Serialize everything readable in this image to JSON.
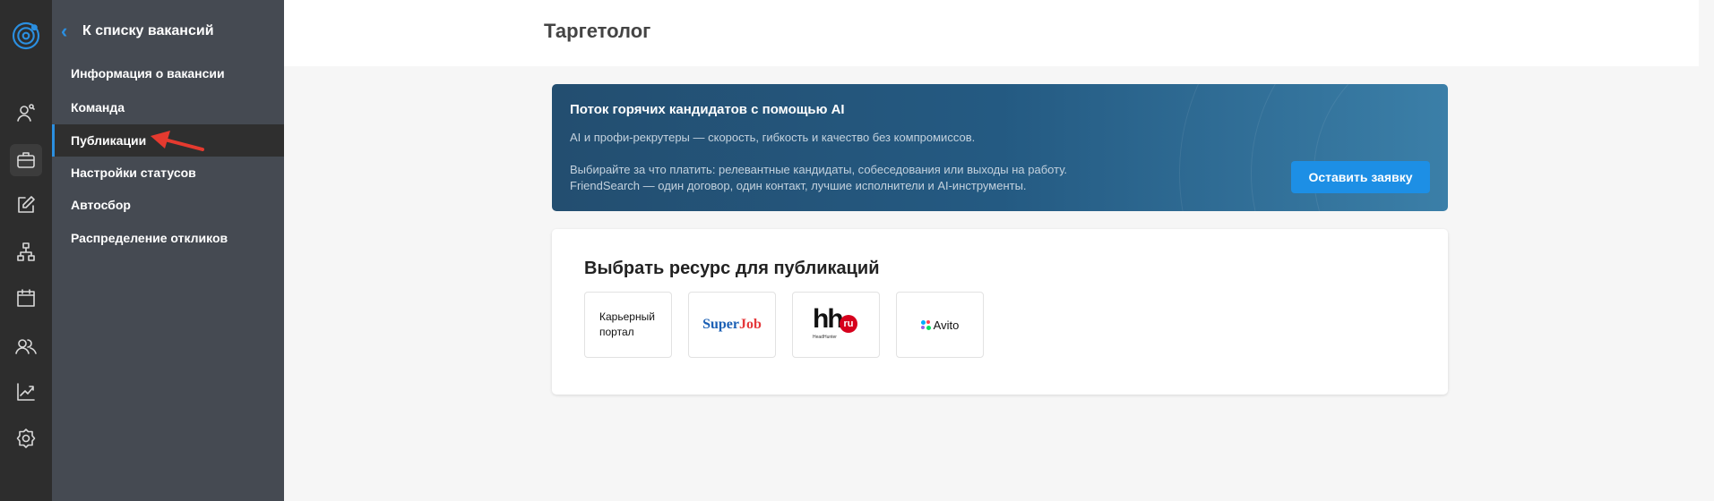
{
  "nav": {
    "back_label": "К списку вакансий",
    "items": [
      {
        "label": "Информация о вакансии"
      },
      {
        "label": "Команда"
      },
      {
        "label": "Публикации",
        "active": true
      },
      {
        "label": "Настройки статусов"
      },
      {
        "label": "Автосбор"
      },
      {
        "label": "Распределение откликов"
      }
    ]
  },
  "header": {
    "title": "Таргетолог"
  },
  "banner": {
    "title": "Поток горячих кандидатов с помощью AI",
    "line1": "AI и профи-рекрутеры — скорость, гибкость и качество без компромиссов.",
    "line2": "Выбирайте за что платить: релевантные кандидаты, собеседования или выходы на работу.",
    "line3": "FriendSearch — один договор, один контакт, лучшие исполнители и AI-инструменты.",
    "button": "Оставить заявку"
  },
  "resources": {
    "title": "Выбрать ресурс для публикаций",
    "career_portal": "Карьерный портал",
    "superjob_a": "Super",
    "superjob_b": "Job",
    "hh": "hh",
    "hh_ru": "ru",
    "hh_sub": "HeadHunter",
    "avito": "Avito"
  },
  "colors": {
    "accent": "#1d8fe5",
    "rail": "#2d2d2d",
    "nav": "#454a52"
  }
}
